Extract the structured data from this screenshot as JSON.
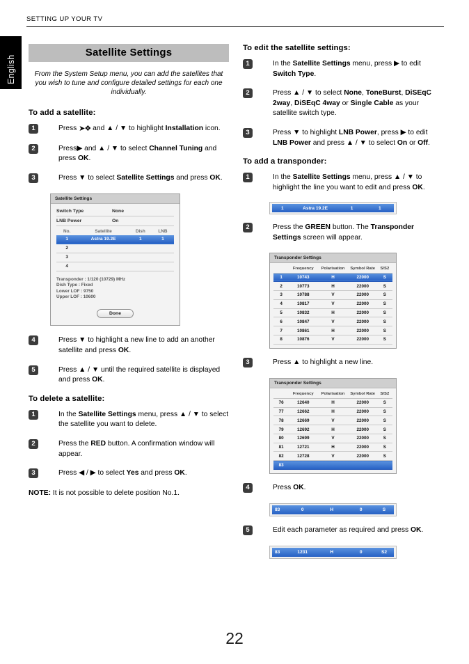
{
  "header": {
    "running_head": "SETTING UP YOUR TV"
  },
  "side_tab": {
    "language": "English"
  },
  "page_number": "22",
  "left": {
    "banner_title": "Satellite Settings",
    "intro": "From the System Setup menu, you can add the satellites that you wish to tune and configure detailed settings for each one individually.",
    "section_add": "To add a satellite:",
    "steps_add": [
      {
        "num": "1",
        "html": "Press <span class=\"wrench\">➤❖</span> and ▲ / ▼ to highlight <b>Installation</b> icon."
      },
      {
        "num": "2",
        "html": "Press▶ and ▲ / ▼ to select <b>Channel Tuning</b> and press <b>OK</b>."
      },
      {
        "num": "3",
        "html": "Press ▼ to select <b>Satellite Settings</b> and press <b>OK</b>."
      },
      {
        "num": "4",
        "html": "Press ▼ to highlight a new line to add an another satellite and press <b>OK</b>."
      },
      {
        "num": "5",
        "html": "Press ▲ / ▼ until the required satellite is displayed and press <b>OK</b>."
      }
    ],
    "section_delete": "To delete a satellite:",
    "steps_delete": [
      {
        "num": "1",
        "html": "In the <b>Satellite Settings</b> menu, press ▲ / ▼ to select the satellite you want to delete."
      },
      {
        "num": "2",
        "html": "Press the <b>RED</b> button. A confirmation window will appear."
      },
      {
        "num": "3",
        "html": "Press ◀ / ▶ to select <b>Yes</b> and press <b>OK</b>."
      }
    ],
    "note": "<b>NOTE:</b> It is not possible to delete position No.1."
  },
  "sat_panel": {
    "title": "Satellite Settings",
    "switch_type_label": "Switch Type",
    "switch_type_value": "None",
    "lnb_power_label": "LNB Power",
    "lnb_power_value": "On",
    "columns": [
      "No.",
      "Satellite",
      "Dish",
      "LNB"
    ],
    "rows": [
      {
        "no": "1",
        "satellite": "Astra 19.2E",
        "dish": "1",
        "lnb": "1",
        "selected": true
      },
      {
        "no": "2",
        "satellite": "",
        "dish": "",
        "lnb": "",
        "selected": false
      },
      {
        "no": "3",
        "satellite": "",
        "dish": "",
        "lnb": "",
        "selected": false
      },
      {
        "no": "4",
        "satellite": "",
        "dish": "",
        "lnb": "",
        "selected": false
      }
    ],
    "info": [
      "Transponder : 1/120 (10729) MHz",
      "Dish Type : Fixed",
      "Lower LOF : 9750",
      "Upper LOF : 10600"
    ],
    "done_label": "Done"
  },
  "right": {
    "section_edit": "To edit the satellite settings:",
    "steps_edit": [
      {
        "num": "1",
        "html": "In the <b>Satellite Settings</b> menu, press ▶ to edit <b>Switch Type</b>."
      },
      {
        "num": "2",
        "html": "Press ▲ / ▼ to select <b>None</b>, <b>ToneBurst</b>, <b>DiSEqC 2way</b>, <b>DiSEqC 4way</b> or <b>Single Cable</b> as your satellite switch type."
      },
      {
        "num": "3",
        "html": "Press ▼ to highlight <b>LNB Power</b>, press ▶ to edit <b>LNB Power</b> and press ▲ / ▼ to select <b>On</b> or <b>Off</b>."
      }
    ],
    "section_transponder": "To add a transponder:",
    "steps_transponder": [
      {
        "num": "1",
        "html": "In the <b>Satellite Settings</b> menu, press ▲ / ▼ to highlight the line you want to edit and press <b>OK</b>."
      },
      {
        "num": "2",
        "html": "Press the <b>GREEN</b> button. The <b>Transponder Settings</b> screen will appear."
      },
      {
        "num": "3",
        "html": "Press ▲ to highlight a new line."
      },
      {
        "num": "4",
        "html": "Press <b>OK</b>."
      },
      {
        "num": "5",
        "html": "Edit each parameter as required and press <b>OK</b>."
      }
    ]
  },
  "sat_strip": {
    "cells": [
      "1",
      "Astra 19.2E",
      "1",
      "1"
    ]
  },
  "tp_table_1": {
    "title": "Transponder Settings",
    "columns": [
      "",
      "Frequency",
      "Polarisation",
      "Symbol Rate",
      "S/S2"
    ],
    "rows": [
      {
        "idx": "1",
        "freq": "10743",
        "pol": "H",
        "sym": "22000",
        "s2": "S",
        "selected": true
      },
      {
        "idx": "2",
        "freq": "10773",
        "pol": "H",
        "sym": "22000",
        "s2": "S",
        "selected": false
      },
      {
        "idx": "3",
        "freq": "10788",
        "pol": "V",
        "sym": "22000",
        "s2": "S",
        "selected": false
      },
      {
        "idx": "4",
        "freq": "10817",
        "pol": "V",
        "sym": "22000",
        "s2": "S",
        "selected": false
      },
      {
        "idx": "5",
        "freq": "10832",
        "pol": "H",
        "sym": "22000",
        "s2": "S",
        "selected": false
      },
      {
        "idx": "6",
        "freq": "10847",
        "pol": "V",
        "sym": "22000",
        "s2": "S",
        "selected": false
      },
      {
        "idx": "7",
        "freq": "10861",
        "pol": "H",
        "sym": "22000",
        "s2": "S",
        "selected": false
      },
      {
        "idx": "8",
        "freq": "10876",
        "pol": "V",
        "sym": "22000",
        "s2": "S",
        "selected": false
      }
    ]
  },
  "tp_table_2": {
    "title": "Transponder Settings",
    "columns": [
      "",
      "Frequency",
      "Polarisation",
      "Symbol Rate",
      "S/S2"
    ],
    "rows": [
      {
        "idx": "76",
        "freq": "12640",
        "pol": "H",
        "sym": "22000",
        "s2": "S",
        "selected": false
      },
      {
        "idx": "77",
        "freq": "12662",
        "pol": "H",
        "sym": "22000",
        "s2": "S",
        "selected": false
      },
      {
        "idx": "78",
        "freq": "12669",
        "pol": "V",
        "sym": "22000",
        "s2": "S",
        "selected": false
      },
      {
        "idx": "79",
        "freq": "12692",
        "pol": "H",
        "sym": "22000",
        "s2": "S",
        "selected": false
      },
      {
        "idx": "80",
        "freq": "12699",
        "pol": "V",
        "sym": "22000",
        "s2": "S",
        "selected": false
      },
      {
        "idx": "81",
        "freq": "12721",
        "pol": "H",
        "sym": "22000",
        "s2": "S",
        "selected": false
      },
      {
        "idx": "82",
        "freq": "12728",
        "pol": "V",
        "sym": "22000",
        "s2": "S",
        "selected": false
      },
      {
        "idx": "83",
        "freq": "",
        "pol": "",
        "sym": "",
        "s2": "",
        "selected": true
      }
    ]
  },
  "edit_bar_1": {
    "cells": [
      "83",
      "0",
      "H",
      "0",
      "S"
    ]
  },
  "edit_bar_2": {
    "cells": [
      "83",
      "1231",
      "H",
      "0",
      "S2"
    ]
  },
  "colors": {
    "banner_bg": "#bdbdbd",
    "selection_blue": "#2660c4",
    "panel_header": "#cfcfcf",
    "step_badge": "#3b3b3b"
  }
}
